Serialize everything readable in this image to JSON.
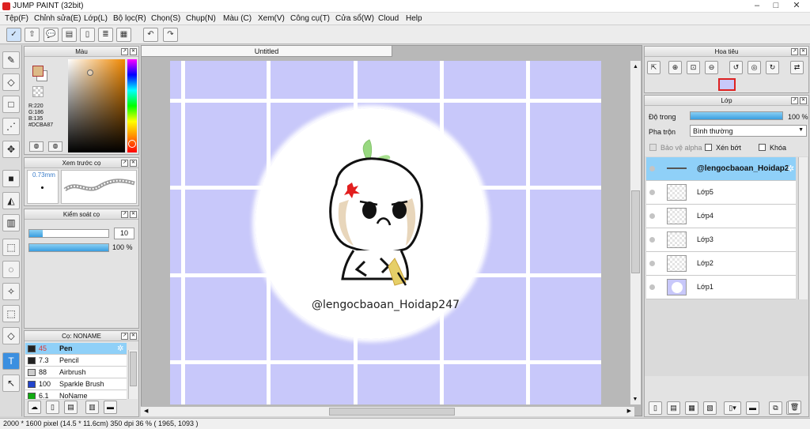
{
  "app": {
    "title": "JUMP PAINT (32bit)"
  },
  "menu": [
    "Tệp(F)",
    "Chỉnh sửa(E)",
    "Lớp(L)",
    "Bộ lọc(R)",
    "Chọn(S)",
    "Chụp(N)",
    "Màu (C)",
    "Xem(V)",
    "Công cụ(T)",
    "Cửa sổ(W)",
    "Cloud",
    "Help"
  ],
  "color_panel": {
    "title": "Màu",
    "r": "R:220",
    "g": "G:186",
    "b": "B:135",
    "hex": "#DCBA87",
    "fg": "#dcba87"
  },
  "brush_preview": {
    "title": "Xem trước cọ",
    "size": "0.73mm"
  },
  "brush_control": {
    "title": "Kiểm soát cọ",
    "size_value": "10",
    "opacity_value": "100 %",
    "size_fraction": 0.1,
    "opacity_fraction": 1.0
  },
  "brush_list": {
    "title": "Cọ: NONAME",
    "items": [
      {
        "size": "45",
        "name": "Pen",
        "color": "#222222"
      },
      {
        "size": "7.3",
        "name": "Pencil",
        "color": "#222222"
      },
      {
        "size": "88",
        "name": "Airbrush",
        "color": "#cccccc"
      },
      {
        "size": "100",
        "name": "Sparkle Brush",
        "color": "#2244cc"
      },
      {
        "size": "6.1",
        "name": "NoName",
        "color": "#11aa11"
      }
    ]
  },
  "document": {
    "tab": "Untitled",
    "signature": "@lengocbaoan_Hoidap247",
    "bg": "#c8c8fa"
  },
  "navigator": {
    "title": "Hoa tiêu"
  },
  "layers_panel": {
    "title": "Lớp",
    "opacity_label": "Độ trong",
    "opacity_value": "100 %",
    "opacity_fraction": 1.0,
    "blend_label": "Pha trộn",
    "blend_value": "Bình thường",
    "protect_alpha": "Bảo vệ alpha",
    "clipping": "Xén bớt",
    "lock": "Khóa",
    "layers": [
      {
        "name": "@lengocbaoan_Hoidap2"
      },
      {
        "name": "Lớp5"
      },
      {
        "name": "Lớp4"
      },
      {
        "name": "Lớp3"
      },
      {
        "name": "Lớp2"
      },
      {
        "name": "Lớp1"
      }
    ]
  },
  "status": {
    "text": "2000 * 1600 pixel   (14.5 * 11.6cm)   350 dpi   36 %   ( 1965, 1093 )"
  }
}
